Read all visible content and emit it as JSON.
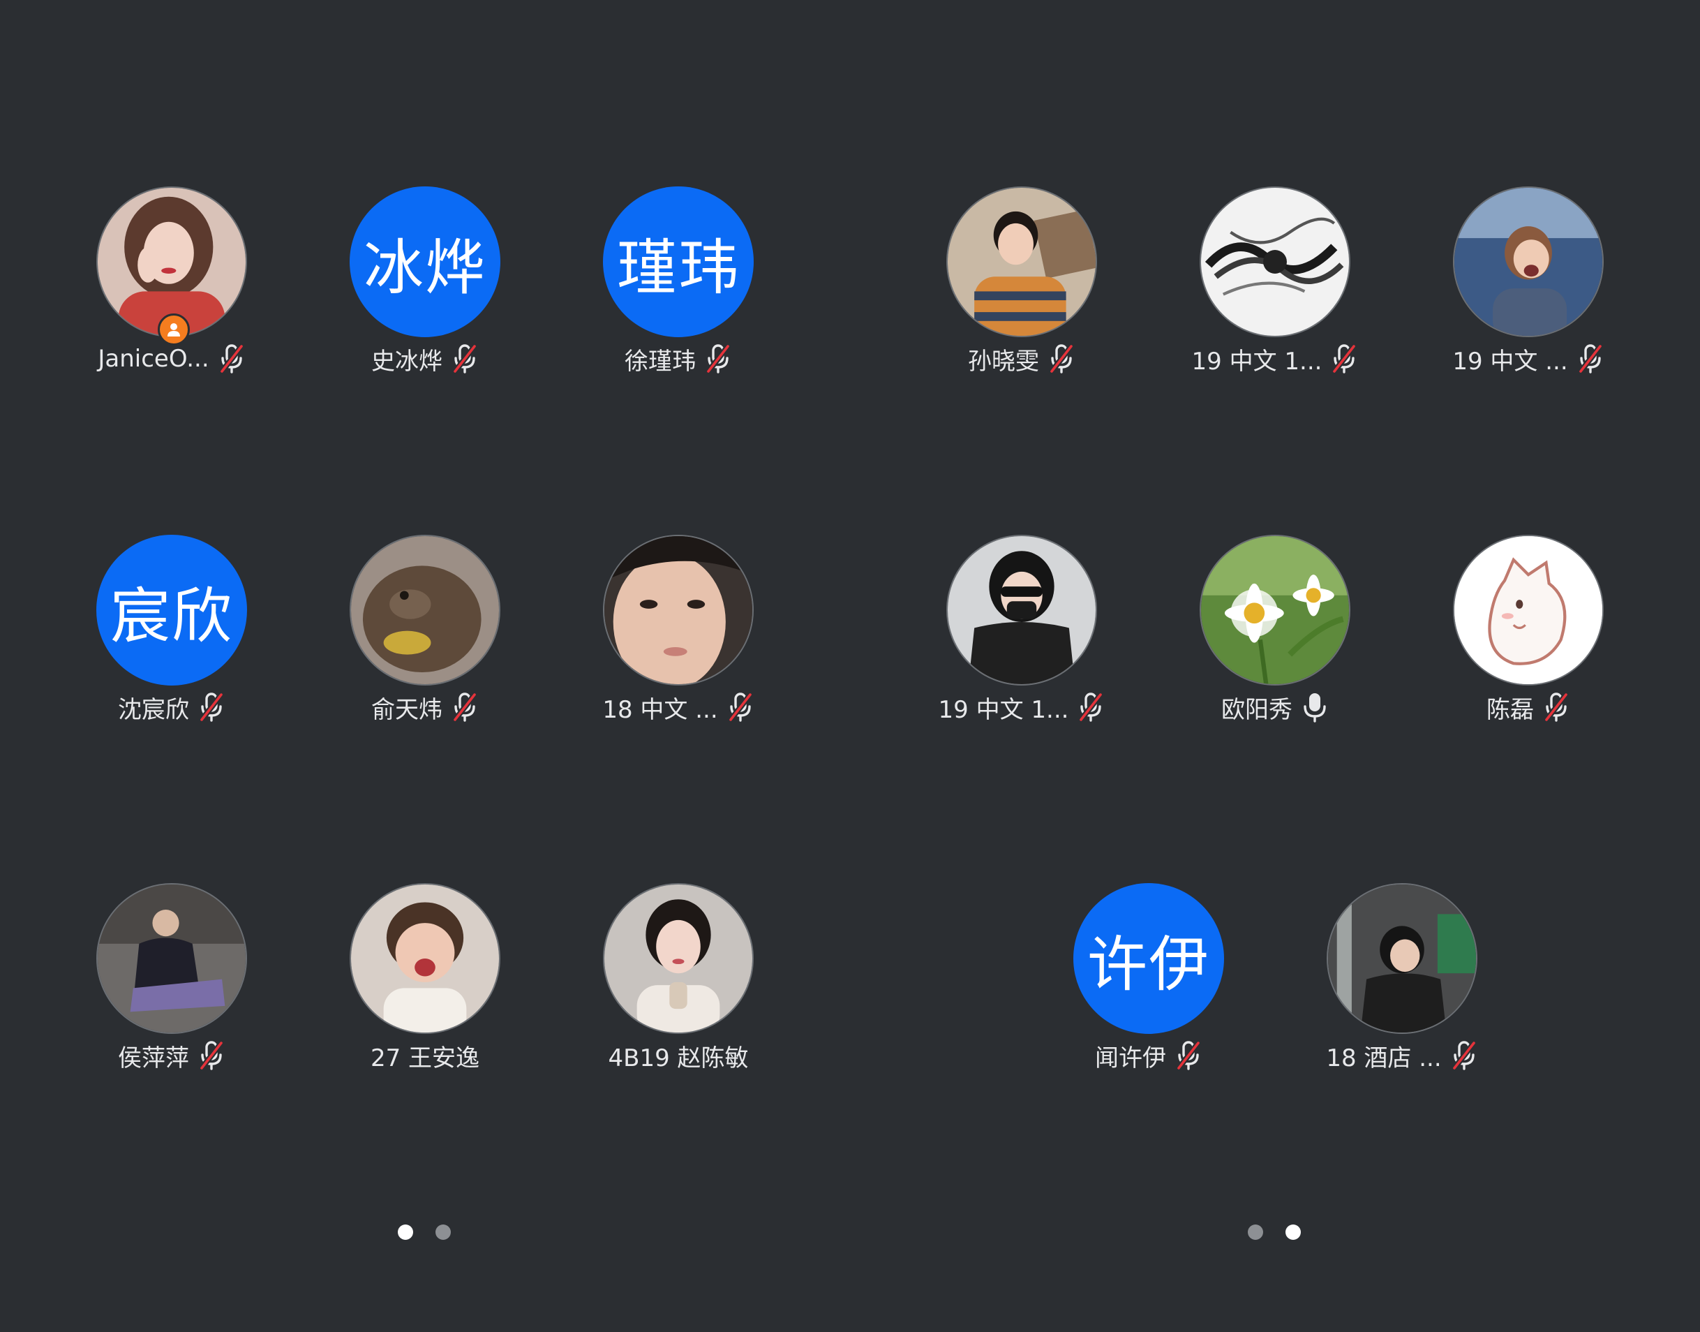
{
  "colors": {
    "background": "#2b2e32",
    "text_avatar_bg": "#0b6bf5",
    "host_badge": "#f57d1f",
    "mute_slash": "#e5333b"
  },
  "panels": [
    {
      "id": "left",
      "participants": [
        {
          "name": "JaniceO...",
          "avatar_type": "photo",
          "host": true,
          "muted": true
        },
        {
          "name": "史冰烨",
          "avatar_type": "text",
          "avatar_text": "冰烨",
          "muted": true
        },
        {
          "name": "徐瑾玮",
          "avatar_type": "text",
          "avatar_text": "瑾玮",
          "muted": true
        },
        {
          "name": "沈宸欣",
          "avatar_type": "text",
          "avatar_text": "宸欣",
          "muted": true
        },
        {
          "name": "俞天炜",
          "avatar_type": "photo",
          "muted": true
        },
        {
          "name": "18 中文 ...",
          "avatar_type": "photo",
          "muted": true
        },
        {
          "name": "侯萍萍",
          "avatar_type": "photo",
          "muted": true
        },
        {
          "name": "27 王安逸",
          "avatar_type": "photo",
          "muted": null
        },
        {
          "name": "4B19 赵陈敏",
          "avatar_type": "photo",
          "muted": null
        }
      ],
      "pager": {
        "count": 2,
        "active": 0
      }
    },
    {
      "id": "right",
      "participants": [
        {
          "name": "孙晓雯",
          "avatar_type": "photo",
          "muted": true
        },
        {
          "name": "19 中文 1...",
          "avatar_type": "photo",
          "muted": true
        },
        {
          "name": "19 中文 ...",
          "avatar_type": "photo",
          "muted": true
        },
        {
          "name": "19 中文 1...",
          "avatar_type": "photo",
          "muted": true
        },
        {
          "name": "欧阳秀",
          "avatar_type": "photo",
          "muted": false
        },
        {
          "name": "陈磊",
          "avatar_type": "photo",
          "muted": true
        },
        {
          "name": "闻许伊",
          "avatar_type": "text",
          "avatar_text": "许伊",
          "muted": true
        },
        {
          "name": "18 酒店 ...",
          "avatar_type": "photo",
          "muted": true
        }
      ],
      "pager": {
        "count": 2,
        "active": 1
      }
    }
  ]
}
